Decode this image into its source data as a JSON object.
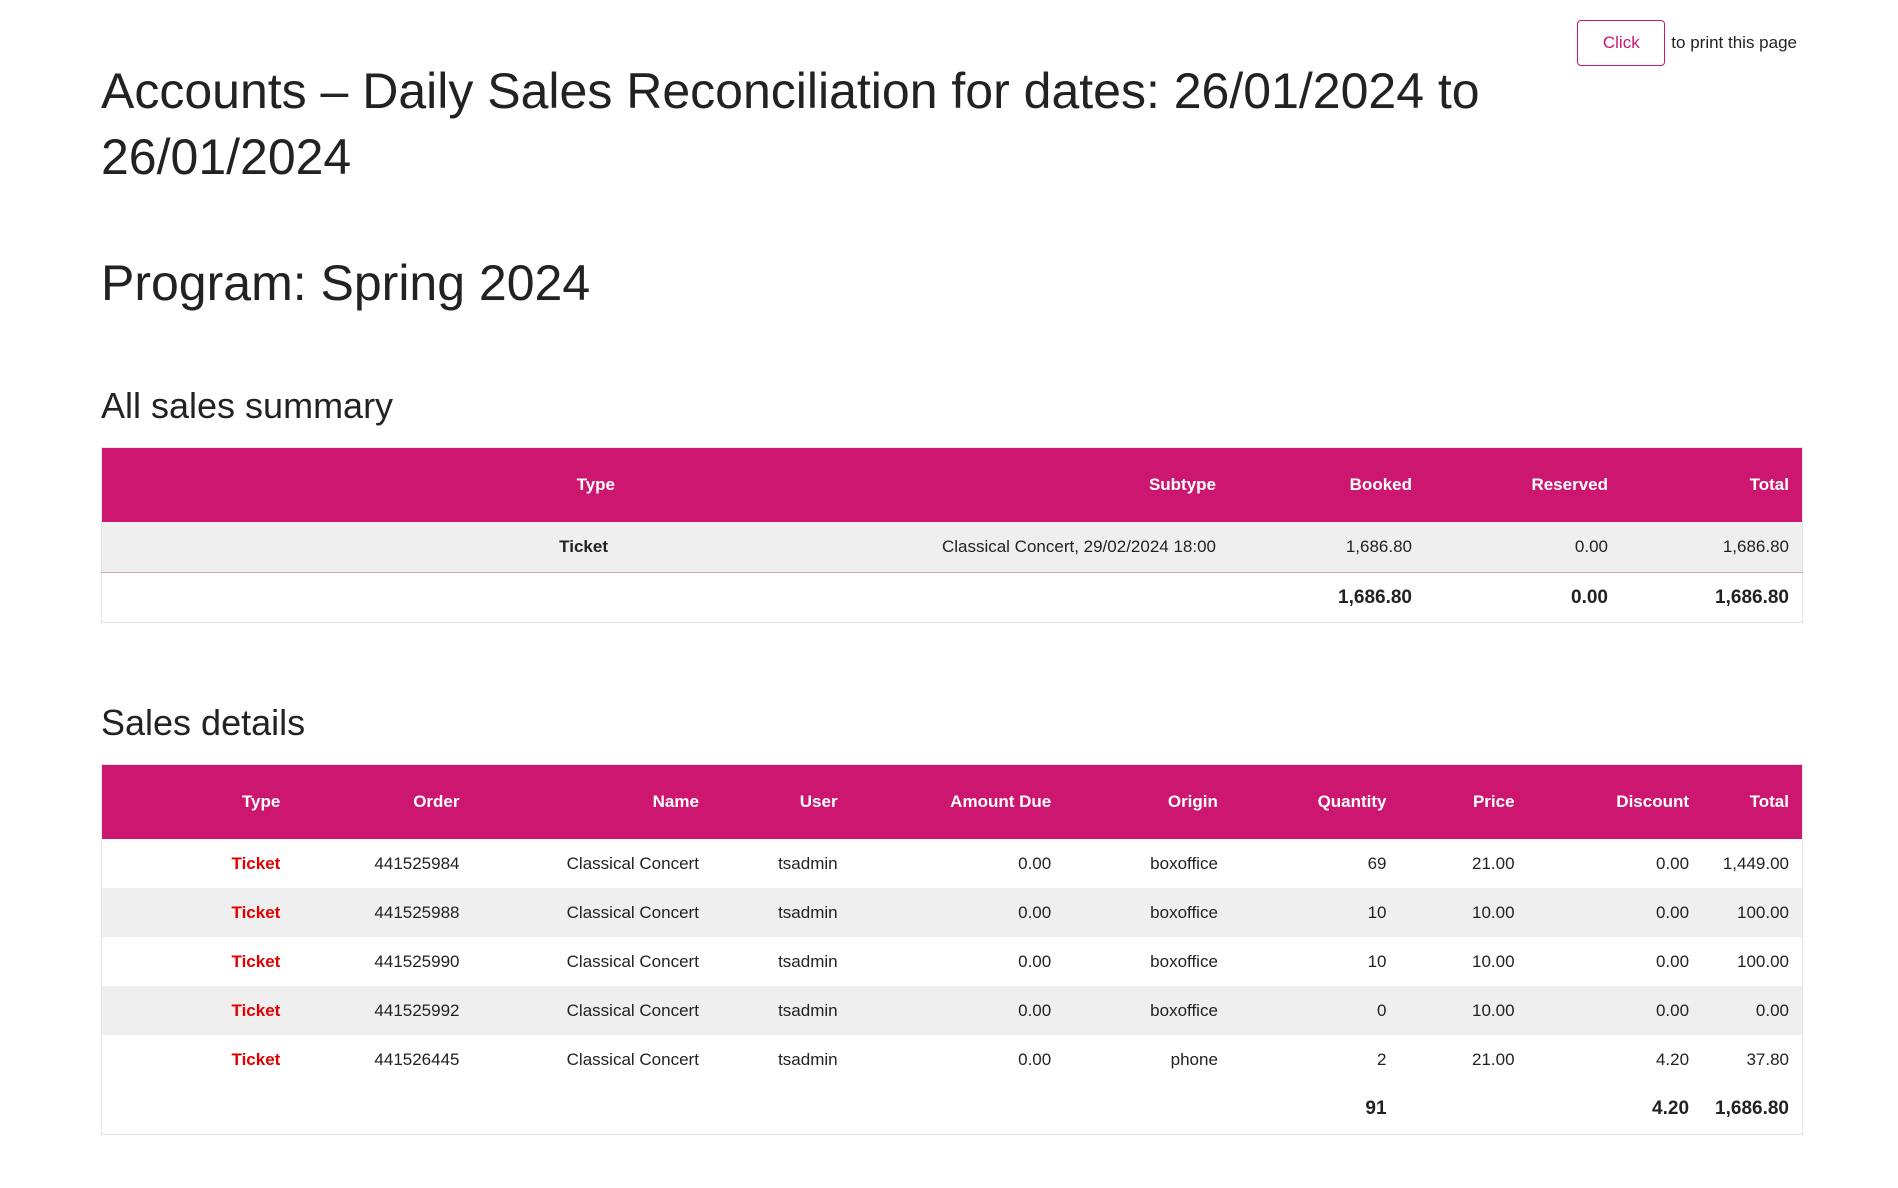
{
  "print": {
    "button_label": "Click",
    "suffix": "to print this page"
  },
  "page_title": "Accounts – Daily Sales Reconciliation for dates: 26/01/2024 to 26/01/2024",
  "program_title": "Program: Spring 2024",
  "summary": {
    "title": "All sales summary",
    "columns": [
      "Type",
      "Subtype",
      "Booked",
      "Reserved",
      "Total"
    ],
    "rows": [
      {
        "type": "Ticket",
        "subtype": "Classical Concert, 29/02/2024 18:00",
        "booked": "1,686.80",
        "reserved": "0.00",
        "total": "1,686.80"
      }
    ],
    "totals": {
      "booked": "1,686.80",
      "reserved": "0.00",
      "total": "1,686.80"
    }
  },
  "details": {
    "title": "Sales details",
    "columns": [
      "Type",
      "Order",
      "Name",
      "User",
      "Amount Due",
      "Origin",
      "Quantity",
      "Price",
      "Discount",
      "Total"
    ],
    "rows": [
      {
        "type": "Ticket",
        "order": "441525984",
        "name": "Classical Concert",
        "user": "tsadmin",
        "amount_due": "0.00",
        "origin": "boxoffice",
        "quantity": "69",
        "price": "21.00",
        "discount": "0.00",
        "total": "1,449.00"
      },
      {
        "type": "Ticket",
        "order": "441525988",
        "name": "Classical Concert",
        "user": "tsadmin",
        "amount_due": "0.00",
        "origin": "boxoffice",
        "quantity": "10",
        "price": "10.00",
        "discount": "0.00",
        "total": "100.00"
      },
      {
        "type": "Ticket",
        "order": "441525990",
        "name": "Classical Concert",
        "user": "tsadmin",
        "amount_due": "0.00",
        "origin": "boxoffice",
        "quantity": "10",
        "price": "10.00",
        "discount": "0.00",
        "total": "100.00"
      },
      {
        "type": "Ticket",
        "order": "441525992",
        "name": "Classical Concert",
        "user": "tsadmin",
        "amount_due": "0.00",
        "origin": "boxoffice",
        "quantity": "0",
        "price": "10.00",
        "discount": "0.00",
        "total": "0.00"
      },
      {
        "type": "Ticket",
        "order": "441526445",
        "name": "Classical Concert",
        "user": "tsadmin",
        "amount_due": "0.00",
        "origin": "phone",
        "quantity": "2",
        "price": "21.00",
        "discount": "4.20",
        "total": "37.80"
      }
    ],
    "totals": {
      "quantity": "91",
      "discount": "4.20",
      "total": "1,686.80"
    }
  },
  "colors": {
    "accent": "#cc1670",
    "type_link": "#e00000",
    "row_stripe": "#efefef"
  }
}
